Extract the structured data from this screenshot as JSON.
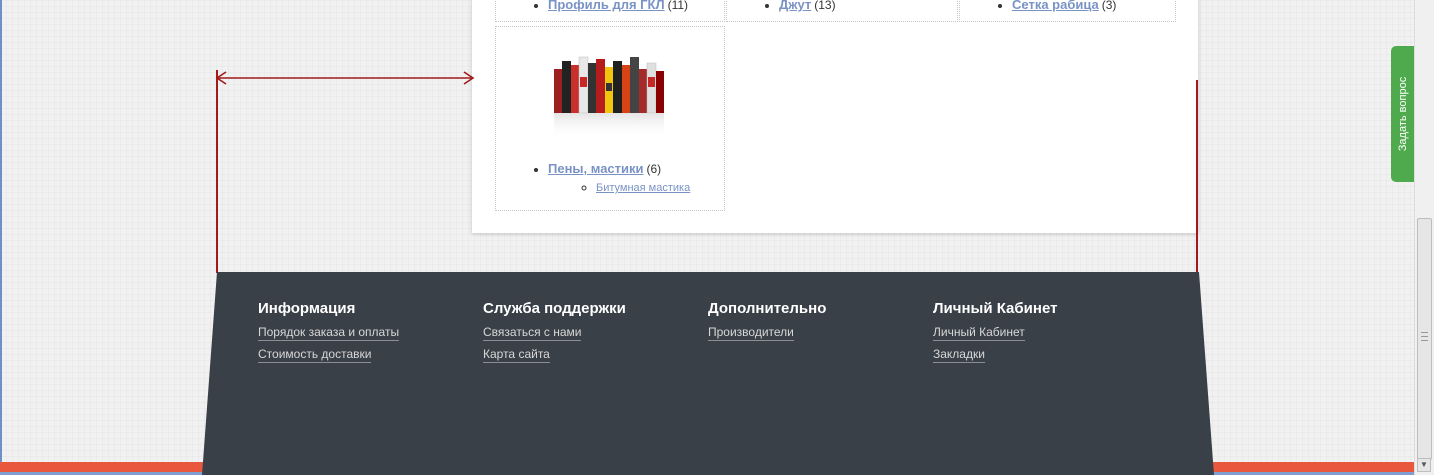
{
  "categories_top": [
    {
      "label": "Профиль для ГКЛ",
      "count": "(11)"
    },
    {
      "label": "Джут",
      "count": "(13)"
    },
    {
      "label": "Сетка рабица",
      "count": "(3)"
    }
  ],
  "category_main": {
    "label": "Пены, мастики",
    "count": "(6)",
    "sub": "Битумная мастика"
  },
  "footer": {
    "columns": [
      {
        "title": "Информация",
        "links": [
          "Порядок заказа и оплаты",
          "Стоимость доставки"
        ]
      },
      {
        "title": "Служба поддержки",
        "links": [
          "Связаться с нами",
          "Карта сайта"
        ]
      },
      {
        "title": "Дополнительно",
        "links": [
          "Производители"
        ]
      },
      {
        "title": "Личный Кабинет",
        "links": [
          "Личный Кабинет",
          "Закладки"
        ]
      }
    ]
  },
  "ask_tab": "Задать вопрос",
  "colors": {
    "footer_bg": "#3a4047",
    "link": "#7a93c5",
    "accent_red": "#e9573f",
    "tab_green": "#4faa4e",
    "annotation": "#a11b1b"
  }
}
